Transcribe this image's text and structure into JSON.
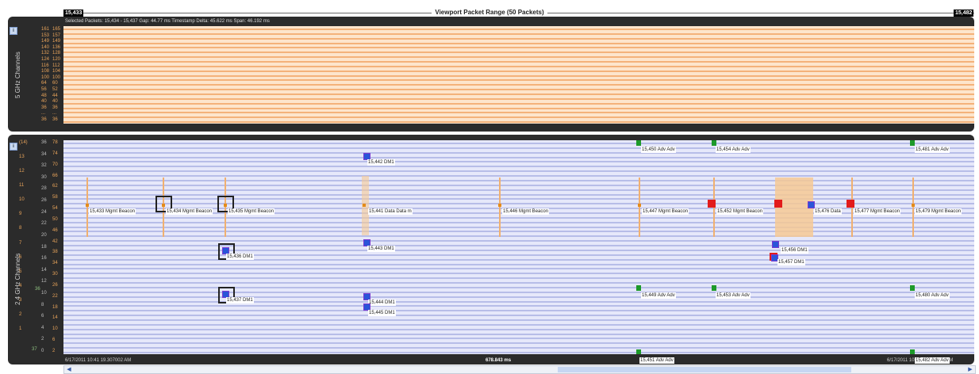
{
  "header": {
    "start_packet": "15,433",
    "end_packet": "15,482",
    "title": "Viewport Packet Range (50 Packets)",
    "status": "Selected Packets: 15,434 - 15,437    Gap: 44.77 ms    Timestamp Delta: 45.622 ms    Span: 46.192 ms"
  },
  "top_panel": {
    "label": "5 GHz Channels",
    "channel_axis": [
      "161",
      "153",
      "149",
      "140",
      "132",
      "124",
      "116",
      "108",
      "100",
      "64",
      "56",
      "48",
      "40",
      "36",
      "...",
      "36"
    ],
    "mhz_axis": [
      "165",
      "157",
      "149",
      "136",
      "128",
      "120",
      "112",
      "104",
      "100",
      "60",
      "52",
      "44",
      "40",
      "36",
      "...",
      "36"
    ]
  },
  "bottom_panel": {
    "label": "2.4 GHz Channels",
    "ch_axis": [
      "(14)",
      "13",
      "12",
      "11",
      "10",
      "9",
      "8",
      "7",
      "6",
      "5",
      "4",
      "3",
      "2",
      "1"
    ],
    "sub_axis_a": [
      "36",
      "34",
      "32",
      "30",
      "28",
      "26",
      "24",
      "22",
      "20",
      "18",
      "16",
      "14",
      "12",
      "10",
      "8",
      "6",
      "4",
      "2",
      "0"
    ],
    "sub_axis_b": [
      "78",
      "74",
      "70",
      "66",
      "62",
      "58",
      "54",
      "50",
      "46",
      "42",
      "38",
      "34",
      "30",
      "26",
      "22",
      "18",
      "14",
      "10",
      "6",
      "2"
    ],
    "special_left": "36",
    "bottom_left": "37"
  },
  "packets": {
    "top_row": [
      "15,450 Adv Adv",
      "15,454 Adv Adv",
      "15,481 Adv Adv"
    ],
    "row_442": "15,442 DM1",
    "beacons": [
      "15,433 Mgmt Beacon",
      "15,434 Mgmt Beacon",
      "15,435 Mgmt Beacon",
      "15,441 Data Data m",
      "15,446 Mgmt Beacon",
      "15,447 Mgmt Beacon",
      "15,452 Mgmt Beacon",
      "15,476 Data",
      "15,477 Mgmt Beacon",
      "15,479 Mgmt Beacon"
    ],
    "row_443": "15,443 DM1",
    "row_436": "15,436 DM1",
    "row_456": "15,456 DM1",
    "row_457": "15,457 DM1",
    "adv_row": [
      "15,449 Adv Adv",
      "15,453 Adv Adv",
      "15,480 Adv Adv"
    ],
    "row_437": "15,437 DM1",
    "row_444": "15,444 DM1",
    "row_445": "15,445 DM1",
    "bottom_adv_1": "15,451 Adv Adv",
    "bottom_adv_2": "15,482 Adv Adv"
  },
  "footer": {
    "left_time": "6/17/2011 10:41 19.307002 AM",
    "center_span": "678.843 ms",
    "right_time": "6/17/2011 10:41 19.985845 AM"
  },
  "colors": {
    "panel_bg": "#2b2b2b",
    "grid_5ghz_bg": "#fde5cc",
    "grid_5ghz_line": "#f4b27a",
    "grid_24ghz_bg": "#e6e8fa",
    "grid_24ghz_line": "#b7bde8",
    "accent_orange": "#e38b1b",
    "accent_blue": "#2a55d8",
    "accent_green": "#1d9a2a",
    "accent_red": "#e21b1b"
  }
}
